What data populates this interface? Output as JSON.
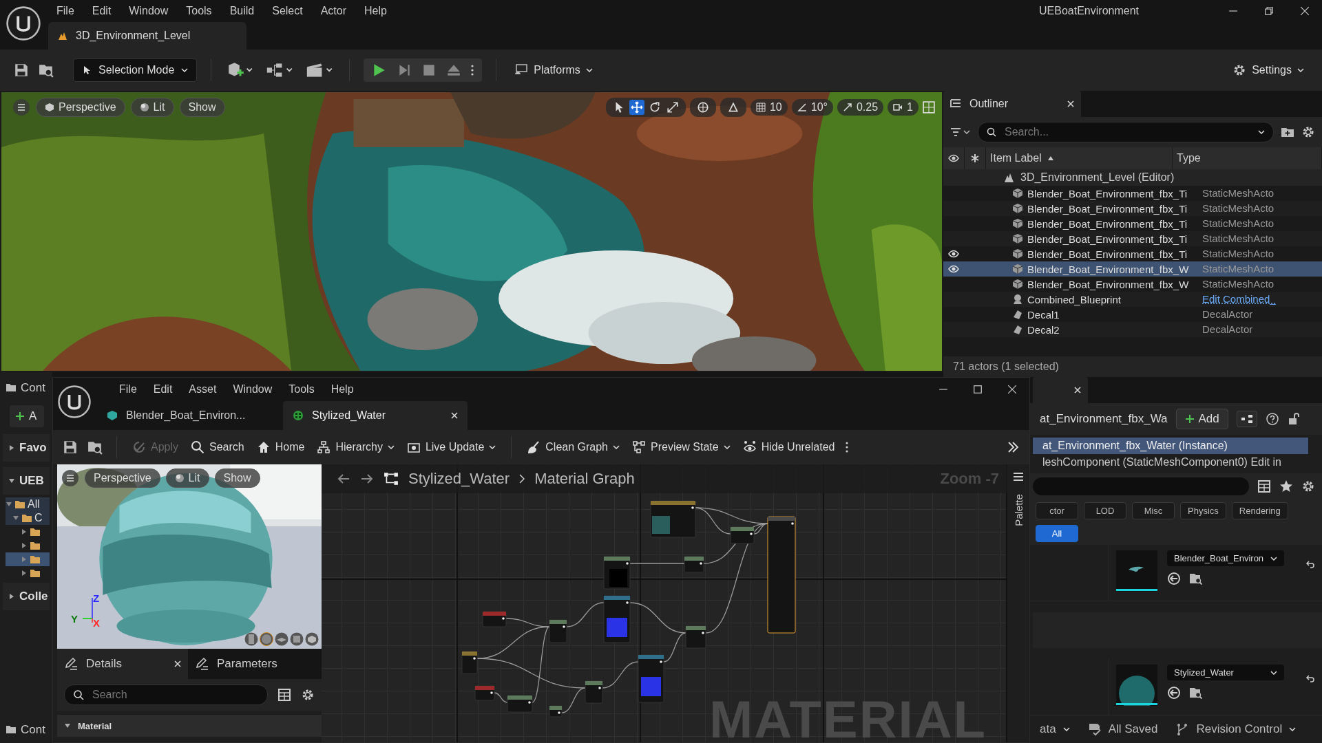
{
  "app": {
    "title": "UEBoatEnvironment",
    "menu": [
      "File",
      "Edit",
      "Window",
      "Tools",
      "Build",
      "Select",
      "Actor",
      "Help"
    ],
    "level_tab": "3D_Environment_Level"
  },
  "toolbar": {
    "mode": "Selection Mode",
    "platforms": "Platforms",
    "settings": "Settings"
  },
  "viewport": {
    "kind": "picture",
    "view": "Perspective",
    "lighting": "Lit",
    "show": "Show",
    "grid": "10",
    "angle": "10°",
    "scale": "0.25",
    "camera": "1"
  },
  "outliner": {
    "title": "Outliner",
    "search": {
      "placeholder": "Search..."
    },
    "columns": [
      "Item Label",
      "Type"
    ],
    "level": "3D_Environment_Level (Editor)",
    "footer": "71 actors (1 selected)",
    "rows": [
      {
        "label": "Blender_Boat_Environment_fbx_Ti",
        "type": "StaticMeshActo",
        "kind": "mesh",
        "visible": false,
        "selected": false,
        "link": false
      },
      {
        "label": "Blender_Boat_Environment_fbx_Ti",
        "type": "StaticMeshActo",
        "kind": "mesh",
        "visible": false,
        "selected": false,
        "link": false
      },
      {
        "label": "Blender_Boat_Environment_fbx_Ti",
        "type": "StaticMeshActo",
        "kind": "mesh",
        "visible": false,
        "selected": false,
        "link": false
      },
      {
        "label": "Blender_Boat_Environment_fbx_Ti",
        "type": "StaticMeshActo",
        "kind": "mesh",
        "visible": false,
        "selected": false,
        "link": false
      },
      {
        "label": "Blender_Boat_Environment_fbx_Ti",
        "type": "StaticMeshActo",
        "kind": "mesh",
        "visible": true,
        "selected": false,
        "link": false
      },
      {
        "label": "Blender_Boat_Environment_fbx_W",
        "type": "StaticMeshActo",
        "kind": "mesh",
        "visible": true,
        "selected": true,
        "link": false
      },
      {
        "label": "Blender_Boat_Environment_fbx_W",
        "type": "StaticMeshActo",
        "kind": "mesh",
        "visible": false,
        "selected": false,
        "link": false
      },
      {
        "label": "Combined_Blueprint",
        "type": "Edit Combined_",
        "kind": "blueprint",
        "visible": false,
        "selected": false,
        "link": true
      },
      {
        "label": "Decal1",
        "type": "DecalActor",
        "kind": "decal",
        "visible": false,
        "selected": false,
        "link": false
      },
      {
        "label": "Decal2",
        "type": "DecalActor",
        "kind": "decal",
        "visible": false,
        "selected": false,
        "link": false
      }
    ]
  },
  "content_browser": {
    "tab": "Cont",
    "add": "A",
    "sections": [
      {
        "label": "Favo",
        "expanded": false
      },
      {
        "label": "UEB",
        "expanded": true
      }
    ],
    "tree": [
      {
        "label": "All",
        "expanded": true,
        "children": [
          {
            "label": "C",
            "expanded": true,
            "children": [
              {
                "selected": false
              },
              {
                "selected": false
              },
              {
                "selected": true
              },
              {
                "selected": false
              }
            ]
          }
        ]
      }
    ],
    "collections": {
      "label": "Colle",
      "expanded": false
    },
    "bottom_tab": "Cont"
  },
  "details": {
    "name": "at_Environment_fbx_Wa",
    "add": "Add",
    "components": [
      {
        "label": "at_Environment_fbx_Water (Instance)",
        "selected": true
      },
      {
        "label": "leshComponent (StaticMeshComponent0)  Edit in",
        "selected": false
      }
    ],
    "filters": [
      {
        "label": "ctor",
        "selected": false
      },
      {
        "label": "LOD",
        "selected": false
      },
      {
        "label": "Misc",
        "selected": false
      },
      {
        "label": "Physics",
        "selected": false
      },
      {
        "label": "Rendering",
        "selected": false
      },
      {
        "label": "All",
        "selected": true
      }
    ],
    "properties": [
      {
        "value": "Blender_Boat_Environ",
        "kind": "mesh"
      },
      {
        "value": "Stylized_Water",
        "kind": "sphere"
      }
    ]
  },
  "status_bar": {
    "left": "ata",
    "saved": "All Saved",
    "revision": "Revision Control"
  },
  "material_editor": {
    "menu": [
      "File",
      "Edit",
      "Asset",
      "Window",
      "Tools",
      "Help"
    ],
    "tabs": [
      {
        "label": "Blender_Boat_Environ...",
        "selected": false,
        "kind": "instance"
      },
      {
        "label": "Stylized_Water",
        "selected": true,
        "kind": "material"
      }
    ],
    "toolbar": [
      {
        "label": "Apply",
        "kind": "apply",
        "disabled": true,
        "dropdown": false
      },
      {
        "label": "Search",
        "kind": "search",
        "disabled": false,
        "dropdown": false
      },
      {
        "label": "Home",
        "kind": "home",
        "disabled": false,
        "dropdown": false
      },
      {
        "label": "Hierarchy",
        "kind": "hierarchy",
        "disabled": false,
        "dropdown": true
      },
      {
        "label": "Live Update",
        "kind": "live",
        "disabled": false,
        "dropdown": true
      },
      {
        "label": "Clean Graph",
        "kind": "clean",
        "disabled": false,
        "dropdown": true
      },
      {
        "label": "Preview State",
        "kind": "preview",
        "disabled": false,
        "dropdown": true
      },
      {
        "label": "Hide Unrelated",
        "kind": "hide",
        "disabled": false,
        "dropdown": false
      }
    ],
    "preview": {
      "kind": "picture",
      "view": "Perspective",
      "lighting": "Lit",
      "show": "Show",
      "axes": [
        "Z",
        "Y",
        "X"
      ]
    },
    "details_tabs": [
      {
        "label": "Details",
        "selected": true
      },
      {
        "label": "Parameters",
        "selected": false
      }
    ],
    "details_search": {
      "placeholder": "Search"
    },
    "section": "Material",
    "graph": {
      "breadcrumb": [
        "Stylized_Water",
        "Material Graph"
      ],
      "zoom": "Zoom -7",
      "palette": "Palette",
      "watermark": "MATERIAL",
      "nodes": [
        {
          "color": "#8a7330",
          "kind": "teal"
        },
        {
          "color": "#5d7a5d",
          "kind": "plain"
        },
        {
          "color": "#4a4a4a",
          "kind": "result"
        },
        {
          "color": "#5d7a5d",
          "kind": "black"
        },
        {
          "color": "#5d7a5d",
          "kind": "plain"
        },
        {
          "color": "#2f6f8c",
          "kind": "normal"
        },
        {
          "color": "#9c2a2a",
          "kind": "plain"
        },
        {
          "color": "#5d7a5d",
          "kind": "plain"
        },
        {
          "color": "#5d7a5d",
          "kind": "plain"
        },
        {
          "color": "#8a7330",
          "kind": "plain"
        },
        {
          "color": "#2f6f8c",
          "kind": "normal"
        },
        {
          "color": "#9c2a2a",
          "kind": "plain"
        },
        {
          "color": "#5d7a5d",
          "kind": "plain"
        },
        {
          "color": "#5d7a5d",
          "kind": "plain"
        },
        {
          "color": "#5d7a5d",
          "kind": "plain"
        }
      ]
    }
  }
}
